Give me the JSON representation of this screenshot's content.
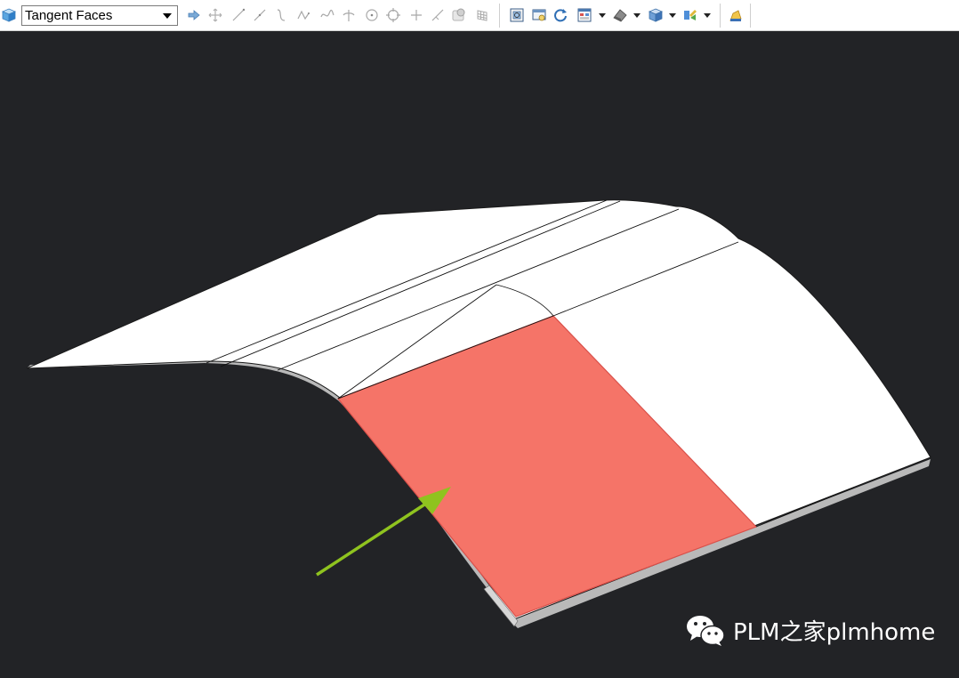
{
  "toolbar": {
    "selection_filter": {
      "selected": "Tangent Faces"
    },
    "icons": [
      "view-cube-icon",
      "arrow-right-icon",
      "move-icon",
      "line-icon",
      "line-icon-2",
      "curve-icon",
      "spline-icon",
      "wave-icon",
      "cross-arc-icon",
      "circle-center-icon",
      "circle-target-icon",
      "plus-icon",
      "diagonal-line-icon",
      "render-sphere-icon",
      "grid-icon",
      "fit-view-icon",
      "zoom-window-icon",
      "rotate-icon",
      "layers-icon",
      "shading-icon",
      "cube-view-icon",
      "display-options-icon",
      "snap-icon"
    ]
  },
  "viewport": {
    "background": "#222326",
    "surface_color": "#ffffff",
    "selected_face_color": "#f57468",
    "arrow_color": "#8fc31f"
  },
  "watermark": {
    "text": "PLM之家plmhome"
  }
}
